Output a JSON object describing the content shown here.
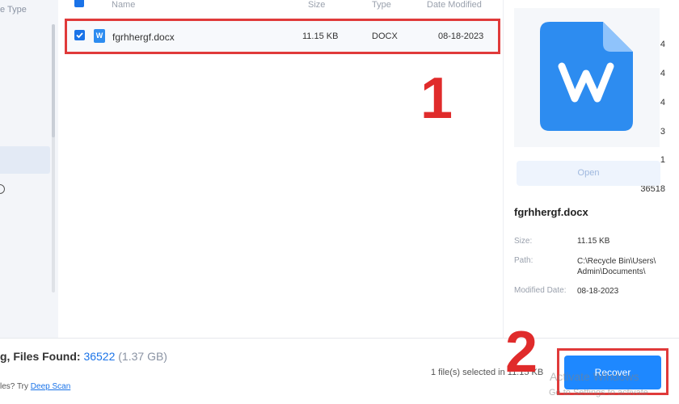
{
  "sidebar": {
    "header": "e Type",
    "counts": [
      "4",
      "4",
      "4",
      "3",
      "1",
      "36518"
    ]
  },
  "table": {
    "headers": {
      "name": "Name",
      "size": "Size",
      "type": "Type",
      "date": "Date Modified"
    },
    "rows": [
      {
        "name": "fgrhhergf.docx",
        "size": "11.15 KB",
        "type": "DOCX",
        "date": "08-18-2023",
        "icon": "word-doc-icon",
        "checked": true
      }
    ]
  },
  "annotations": {
    "step1": "1",
    "step2": "2",
    "highlight_color": "#e03a3a"
  },
  "preview": {
    "open_label": "Open",
    "file_name": "fgrhhergf.docx",
    "size_label": "Size:",
    "size_value": "11.15 KB",
    "path_label": "Path:",
    "path_line1": "C:\\Recycle Bin\\Users\\",
    "path_line2": "Admin\\Documents\\",
    "modified_label": "Modified Date:",
    "modified_value": "08-18-2023"
  },
  "footer": {
    "status_prefix": "g, Files Found:",
    "files_found": "36522",
    "total_size": "(1.37 GB)",
    "hint_text": "les? Try",
    "hint_link": "Deep Scan",
    "selection_info": "1 file(s) selected in 11.15 KB",
    "recover_label": "Recover",
    "accent_color": "#1e88ff"
  },
  "watermark": {
    "line1": "Activate Windows",
    "line2": "Go to Settings to activate"
  }
}
